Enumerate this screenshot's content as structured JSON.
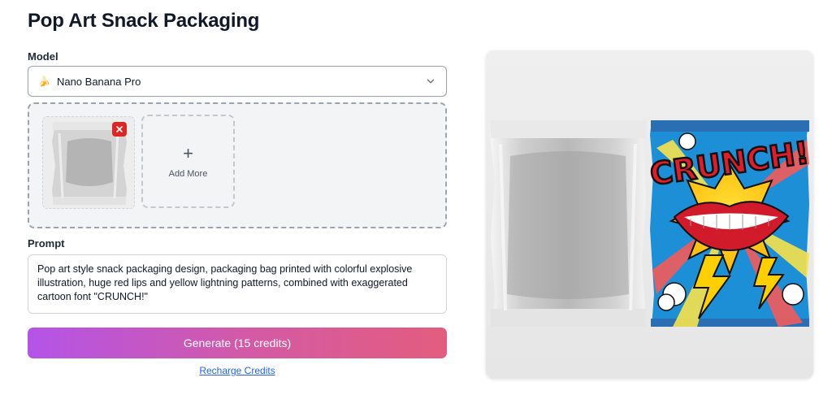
{
  "page": {
    "title": "Pop Art Snack Packaging"
  },
  "model": {
    "label": "Model",
    "selected": "Nano Banana Pro",
    "emoji": "🍌"
  },
  "upload": {
    "add_more_label": "Add More"
  },
  "prompt": {
    "label": "Prompt",
    "value": "Pop art style snack packaging design, packaging bag printed with colorful explosive illustration, huge red lips and yellow lightning patterns, combined with exaggerated cartoon font \"CRUNCH!\""
  },
  "actions": {
    "generate_label": "Generate (15 credits)",
    "recharge_label": "Recharge Credits"
  },
  "preview": {
    "package_text": "CRUNCH!"
  },
  "colors": {
    "accent_start": "#b454e8",
    "accent_end": "#e35d7e",
    "remove_red": "#dc2626",
    "link_blue": "#2563eb"
  }
}
